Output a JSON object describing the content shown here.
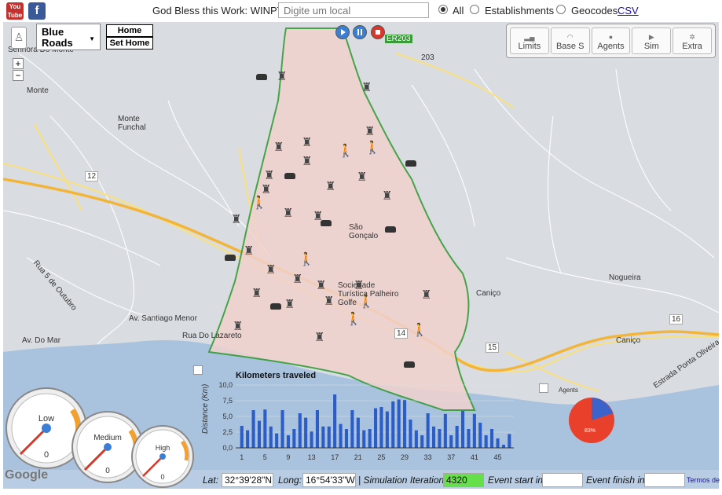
{
  "header": {
    "bless_text": "God Bless this Work: WINPT",
    "search_placeholder": "Digite um local",
    "filters": [
      {
        "label": "All",
        "selected": true
      },
      {
        "label": "Establishments",
        "selected": false
      },
      {
        "label": "Geocodes",
        "selected": false
      }
    ],
    "csv_link": "CSV",
    "youtube_label": "You Tube",
    "facebook_label": "f"
  },
  "map_controls": {
    "map_type": "Blue Roads",
    "home_button": "Home",
    "set_home_button": "Set Home",
    "zoom_in": "+",
    "zoom_out": "−"
  },
  "toolbar": {
    "buttons": [
      {
        "label": "Limits",
        "icon": "bars-icon"
      },
      {
        "label": "Base S",
        "icon": "signal-icon"
      },
      {
        "label": "Agents",
        "icon": "person-icon"
      },
      {
        "label": "Sim",
        "icon": "play-icon"
      },
      {
        "label": "Extra",
        "icon": "gear-icon"
      }
    ]
  },
  "map_labels": [
    "Senhora Do Monte",
    "Monte",
    "Monte Funchal",
    "São Gonçalo",
    "Sociedade Turística Palheiro Golfe",
    "Caniço",
    "Nogueira",
    "Caniço",
    "Rua Do Lazareto",
    "Av. Do Mar",
    "Av. Santiago Menor",
    "Rua 5 de Outubro",
    "Estrada Ponta Oliveira",
    "ER203",
    "203",
    "12",
    "14",
    "15",
    "16",
    "Agents"
  ],
  "gauges": [
    {
      "label": "Low",
      "value": "0"
    },
    {
      "label": "Medium",
      "value": "0"
    },
    {
      "label": "High",
      "value": "0"
    }
  ],
  "pie": {
    "legend_label": "Agents",
    "percent_label": "83%",
    "colors": {
      "major": "#e8402a",
      "minor": "#3b63c9"
    }
  },
  "chart_data": {
    "type": "bar",
    "title": "Kilometers traveled",
    "ylabel": "Distance (Km)",
    "xlabel": "",
    "ylim": [
      0,
      10
    ],
    "yticks": [
      "0,0",
      "2,5",
      "5,0",
      "7,5",
      "10,0"
    ],
    "xtick_labels": [
      "1",
      "5",
      "9",
      "13",
      "17",
      "21",
      "25",
      "29",
      "33",
      "37",
      "41",
      "45"
    ],
    "categories": [
      "1",
      "2",
      "3",
      "4",
      "5",
      "6",
      "7",
      "8",
      "9",
      "10",
      "11",
      "12",
      "13",
      "14",
      "15",
      "16",
      "17",
      "18",
      "19",
      "20",
      "21",
      "22",
      "23",
      "24",
      "25",
      "26",
      "27",
      "28",
      "29",
      "30",
      "31",
      "32",
      "33",
      "34",
      "35",
      "36",
      "37",
      "38",
      "39",
      "40",
      "41",
      "42",
      "43",
      "44",
      "45",
      "46",
      "47"
    ],
    "values": [
      3.5,
      2.8,
      6.0,
      4.3,
      6.1,
      3.4,
      2.3,
      6.0,
      2.0,
      3.0,
      5.5,
      4.8,
      2.6,
      6.0,
      3.4,
      3.4,
      8.5,
      3.8,
      3.0,
      6.0,
      4.8,
      2.8,
      3.0,
      6.3,
      6.5,
      5.8,
      7.4,
      7.7,
      7.6,
      4.5,
      2.8,
      2.0,
      5.5,
      3.4,
      3.0,
      5.4,
      2.0,
      3.5,
      5.9,
      3.0,
      5.4,
      4.0,
      2.0,
      3.0,
      1.5,
      0.5,
      2.2
    ],
    "bar_color": "#2c5cc5"
  },
  "statusbar": {
    "lat_label": "Lat:",
    "lat_value": "32°39'28\"N",
    "long_label": "Long:",
    "long_value": "16°54'33\"W",
    "sim_label": "| Simulation Iteration:",
    "sim_value": "4320",
    "event_start_label": "Event start in:",
    "event_finish_label": "Event finish in:",
    "terms": "Termos de Uso"
  },
  "google_logo": "Google",
  "colors": {
    "sea": "#a9c3df",
    "land": "#d9dde2",
    "region": "#f1d2ce",
    "boundary": "#2e9a2e",
    "highway": "#f7c949"
  }
}
